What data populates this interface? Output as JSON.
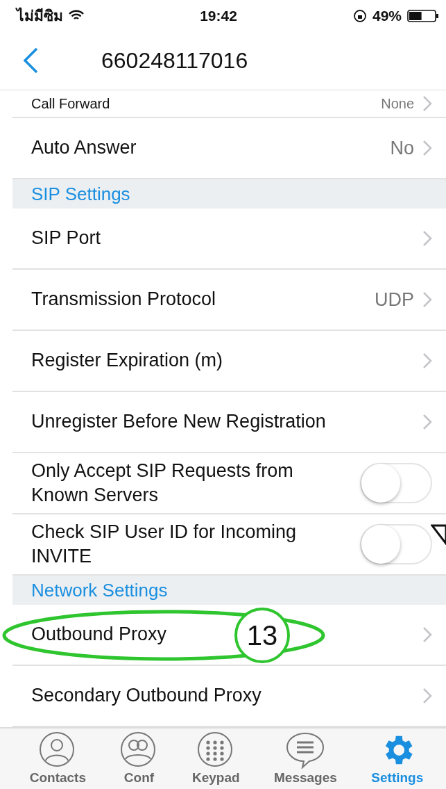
{
  "status_bar": {
    "carrier": "ไม่มีซิม",
    "time": "19:42",
    "battery": "49%",
    "level": 0.49
  },
  "nav": {
    "title": "660248117016"
  },
  "rows": [
    {
      "kind": "clipped",
      "label": "Call Forward",
      "value": "None"
    },
    {
      "kind": "link",
      "label": "Auto Answer",
      "value": "No"
    },
    {
      "kind": "section",
      "label": "SIP Settings"
    },
    {
      "kind": "link",
      "label": "SIP Port"
    },
    {
      "kind": "link",
      "label": "Transmission Protocol",
      "value": "UDP"
    },
    {
      "kind": "link",
      "label": "Register Expiration (m)"
    },
    {
      "kind": "link",
      "label": "Unregister Before New Registration"
    },
    {
      "kind": "toggle",
      "label": "Only Accept SIP Requests from Known Servers",
      "on": false
    },
    {
      "kind": "toggle",
      "label": "Check SIP User ID for Incoming INVITE",
      "on": false
    },
    {
      "kind": "section",
      "label": "Network Settings"
    },
    {
      "kind": "link",
      "label": "Outbound Proxy",
      "callout": "13"
    },
    {
      "kind": "link",
      "label": "Secondary Outbound Proxy"
    }
  ],
  "tabs": [
    {
      "kind": "contacts",
      "label": "Contacts",
      "selected": false
    },
    {
      "kind": "conf",
      "label": "Conf",
      "selected": false
    },
    {
      "kind": "keypad",
      "label": "Keypad",
      "selected": false
    },
    {
      "kind": "messages",
      "label": "Messages",
      "selected": false
    },
    {
      "kind": "settings",
      "label": "Settings",
      "selected": true
    }
  ]
}
